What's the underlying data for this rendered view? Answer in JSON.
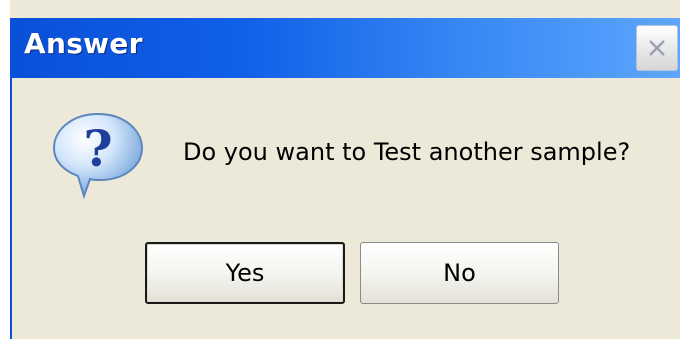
{
  "window": {
    "title": "Answer",
    "close_icon": "close-icon"
  },
  "message": {
    "icon": "question-icon",
    "text": "Do you want to Test another sample?"
  },
  "buttons": {
    "yes_label": "Yes",
    "no_label": "No"
  },
  "colors": {
    "titlebar_start": "#0a50d8",
    "titlebar_end": "#5ea6ff",
    "dialog_background": "#ece9d8"
  }
}
